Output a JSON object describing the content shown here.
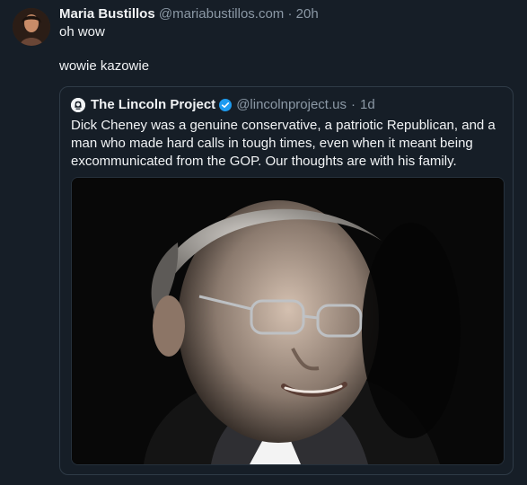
{
  "post": {
    "author_name": "Maria Bustillos",
    "handle": "@mariabustillos.com",
    "separator": "·",
    "time": "20h",
    "lines": [
      "oh wow",
      "wowie kazowie"
    ]
  },
  "quoted_post": {
    "author_name": "The Lincoln Project",
    "handle": "@lincolnproject.us",
    "separator": "·",
    "time": "1d",
    "text": "Dick Cheney was a genuine conservative, a patriotic Republican, and a man who made hard calls in tough times, even when it meant being excommunicated from the GOP. Our thoughts are with his family.",
    "image_icon": "portrait-photo"
  },
  "icons": {
    "author_avatar": "avatar-image",
    "quoted_avatar": "lincoln-logo-icon",
    "verified": "verified-badge-icon"
  },
  "colors": {
    "background": "#161e27",
    "text": "#f1f3f5",
    "muted": "#8b98a5",
    "border": "#2f3b47",
    "verified": "#1d9bf0"
  }
}
